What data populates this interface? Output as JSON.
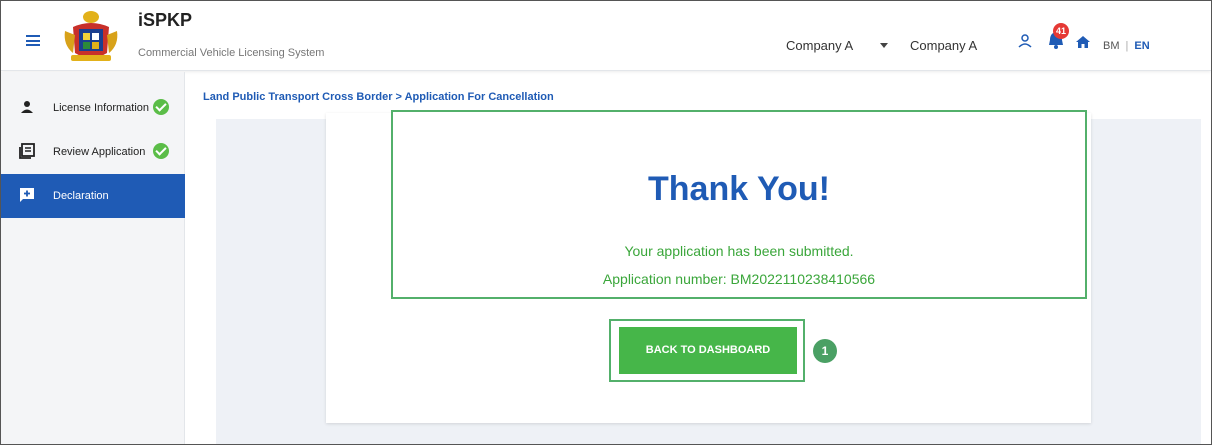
{
  "header": {
    "title": "iSPKP",
    "subtitle": "Commercial Vehicle Licensing System",
    "company_select": "Company A",
    "company_name": "Company A",
    "notification_count": "41",
    "lang_bm": "BM",
    "lang_sep": "|",
    "lang_en": "EN"
  },
  "sidebar": {
    "items": [
      {
        "label": "License Information",
        "icon": "person-icon",
        "completed": true
      },
      {
        "label": "Review Application",
        "icon": "document-icon",
        "completed": true
      },
      {
        "label": "Declaration",
        "icon": "message-plus-icon",
        "active": true
      }
    ]
  },
  "breadcrumb": "Land Public Transport Cross Border > Application For Cancellation",
  "confirmation": {
    "heading": "Thank You!",
    "message": "Your application has been submitted.",
    "application_number": "Application number: BM2022110238410566"
  },
  "button": {
    "label": "BACK TO DASHBOARD"
  },
  "step_marker": "1",
  "colors": {
    "primary": "#1f5bb5",
    "success": "#46b649",
    "success_text": "#3aa63a",
    "badge": "#e53935"
  }
}
